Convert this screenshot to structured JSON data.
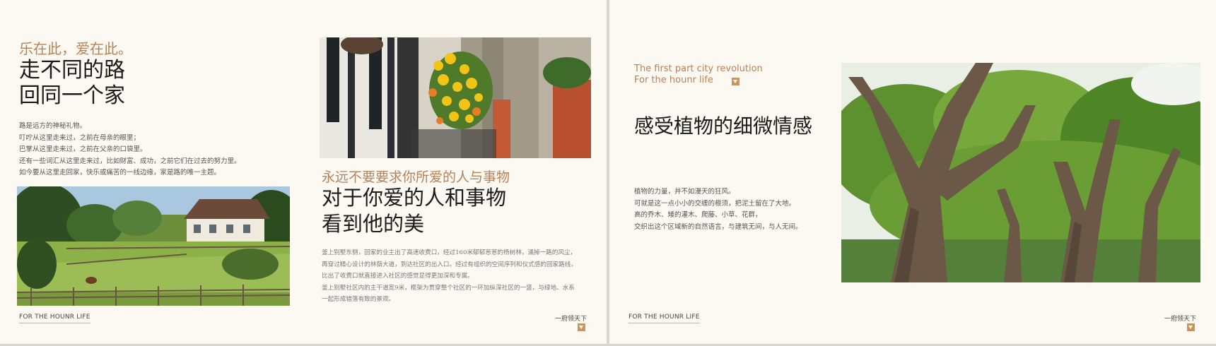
{
  "left_slide": {
    "tagline": "乐在此，爱在此。",
    "title_lines": [
      "走不同的路",
      "回同一个家"
    ],
    "body_lines": [
      "路是远方的神秘礼物。",
      "叮咛从这里走来过，之前在母亲的眼里；",
      "巴掌从这里走来过，之前在父亲的口袋里。",
      "还有一些词汇从这里走来过，比如财富、成功，之前它们在过去的努力里。",
      "如今要从这里走回家，快乐或痛苦的一线边缘，家是路的唯一主题。"
    ],
    "middle_tagline": "永远不要要求你所爱的人与事物",
    "middle_title_lines": [
      "对于你爱的人和事物",
      "看到他的美"
    ],
    "middle_body_lines": [
      "釜上别墅东侧，回家的业主出了高速收费口，经过160米郁郁葱葱的杨树林，涌掉一路的风尘，",
      "再穿过精心设计的林荫大道，到达社区的出入口。经过有组织的空间序列和仪式感的回家路线，",
      "比出了收费口就直接进入社区的感觉显得更加深和专属。",
      "釜上别墅社区内的主干道宽9米，框架为贯穿整个社区的一环加纵深社区的一竖，与绿地、水系",
      "一起形成错落有致的景观。"
    ],
    "footer_left": "FOR THE HOUNR LIFE",
    "footer_right": "一府领天下"
  },
  "right_slide": {
    "english_lines": [
      "The first part city revolution",
      "For the hounr life"
    ],
    "title": "感受植物的细微情感",
    "body_lines": [
      "植物的力量，并不如漫天的狂风。",
      "可就是这一点小小的交缠的根须，把泥土留在了大地。",
      "高的乔木、矮的灌木、爬藤、小草、花群，",
      "交织出这个区域新的自然语言，与建筑无间，与人无间。"
    ],
    "footer_left": "FOR THE HOUNR LIFE",
    "footer_right": "一府领天下"
  },
  "colors": {
    "accent": "#b5835a",
    "background": "#fcf8f2",
    "badge": "#c9955f"
  },
  "icons": [
    "arrow-down-badge-icon"
  ]
}
